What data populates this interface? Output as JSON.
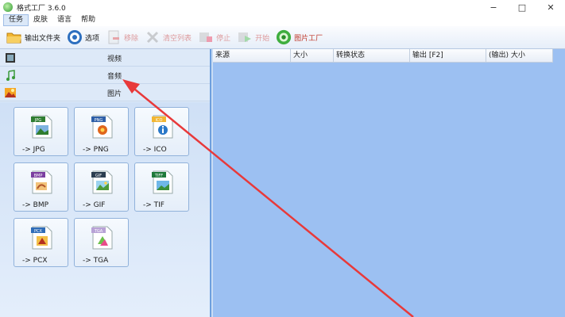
{
  "window": {
    "title": "格式工厂 3.6.0",
    "controls": [
      "−",
      "□",
      "✕"
    ]
  },
  "menu": [
    "任务",
    "皮肤",
    "语言",
    "帮助"
  ],
  "toolbar": {
    "output_folder": "输出文件夹",
    "options": "选项",
    "remove": "移除",
    "clear_list": "清空列表",
    "stop": "停止",
    "start": "开始",
    "image_factory": "图片工厂"
  },
  "categories": {
    "video": "视频",
    "audio": "音频",
    "image": "图片"
  },
  "tiles": {
    "jpg": {
      "badge": "JPG",
      "label": "-> JPG"
    },
    "png": {
      "badge": "PNG",
      "label": "-> PNG"
    },
    "ico": {
      "badge": "ICO",
      "label": "-> ICO"
    },
    "bmp": {
      "badge": "BMP",
      "label": "-> BMP"
    },
    "gif": {
      "badge": "GIF",
      "label": "-> GIF"
    },
    "tif": {
      "badge": "TIFF",
      "label": "-> TIF"
    },
    "pcx": {
      "badge": "PCX",
      "label": "-> PCX"
    },
    "tga": {
      "badge": "TGA",
      "label": "-> TGA"
    }
  },
  "columns": [
    "来源",
    "大小",
    "转换状态",
    "输出 [F2]",
    "(输出) 大小"
  ],
  "colors": {
    "annotation_arrow": "#e8393a",
    "list_background": "#9cc0f2"
  },
  "icons": {
    "output_folder": "folder-icon",
    "options": "gear-icon",
    "remove": "delete-icon",
    "clear_list": "clear-list-icon",
    "stop": "stop-icon",
    "start": "start-icon",
    "image_factory": "picture-factory-icon"
  }
}
